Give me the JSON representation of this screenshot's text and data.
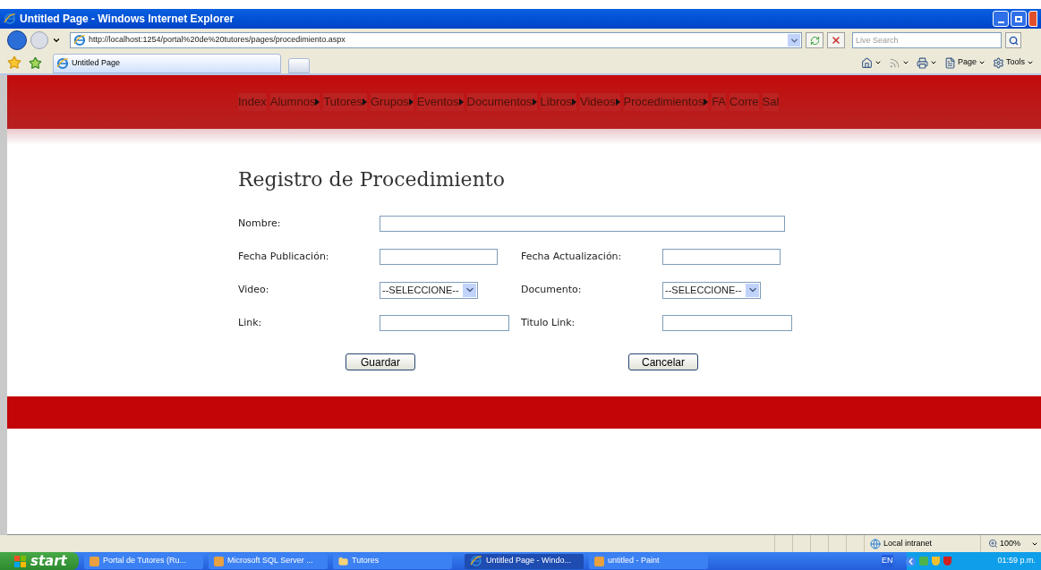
{
  "window": {
    "title": "Untitled Page - Windows Internet Explorer"
  },
  "address_bar": {
    "url": "http://localhost:1254/portal%20de%20tutores/pages/procedimiento.aspx"
  },
  "search": {
    "placeholder": "Live Search"
  },
  "tabs": [
    {
      "label": "Untitled Page",
      "selected": true
    }
  ],
  "command_bar": [
    {
      "kind": "home"
    },
    {
      "kind": "feeds"
    },
    {
      "kind": "print"
    },
    {
      "kind": "page",
      "label": "Page"
    },
    {
      "kind": "tools",
      "label": "Tools"
    }
  ],
  "menu": [
    {
      "label": "Index",
      "submenu": false
    },
    {
      "label": "Alumnos",
      "submenu": true
    },
    {
      "label": "Tutores",
      "submenu": true
    },
    {
      "label": "Grupos",
      "submenu": true
    },
    {
      "label": "Eventos",
      "submenu": true
    },
    {
      "label": "Documentos",
      "submenu": true
    },
    {
      "label": "Libros",
      "submenu": true
    },
    {
      "label": "Videos",
      "submenu": true
    },
    {
      "label": "Procedimientos",
      "submenu": true
    },
    {
      "label": "FA",
      "submenu": false
    },
    {
      "label": "Corre",
      "submenu": false
    },
    {
      "label": "Sal",
      "submenu": false
    }
  ],
  "form": {
    "title": "Registro de Procedimiento",
    "rows": [
      [
        {
          "kind": "text",
          "label": "Nombre:"
        }
      ],
      [
        {
          "kind": "text",
          "label": "Fecha Publicación:"
        },
        {
          "kind": "text",
          "label": "Fecha Actualización:"
        }
      ],
      [
        {
          "kind": "select",
          "label": "Video:",
          "value": "--SELECCIONE--"
        },
        {
          "kind": "select",
          "label": "Documento:",
          "value": "--SELECCIONE--"
        }
      ],
      [
        {
          "kind": "text",
          "label": "Link:"
        },
        {
          "kind": "text",
          "label": "Titulo Link:"
        }
      ]
    ],
    "buttons": [
      "Guardar",
      "Cancelar"
    ]
  },
  "status_bar": {
    "zone": "Local intranet",
    "zoom": "100%"
  },
  "taskbar": {
    "start": "start",
    "items": [
      {
        "label": "Portal de Tutores (Ru...",
        "selected": false
      },
      {
        "label": "Microsoft SQL Server ...",
        "selected": false
      },
      {
        "label": "Tutores",
        "selected": false
      },
      {
        "label": "Untitled Page - Windo...",
        "selected": true
      },
      {
        "label": "untitled - Paint",
        "selected": false
      }
    ],
    "language": "EN",
    "clock": "01:59 p.m."
  }
}
